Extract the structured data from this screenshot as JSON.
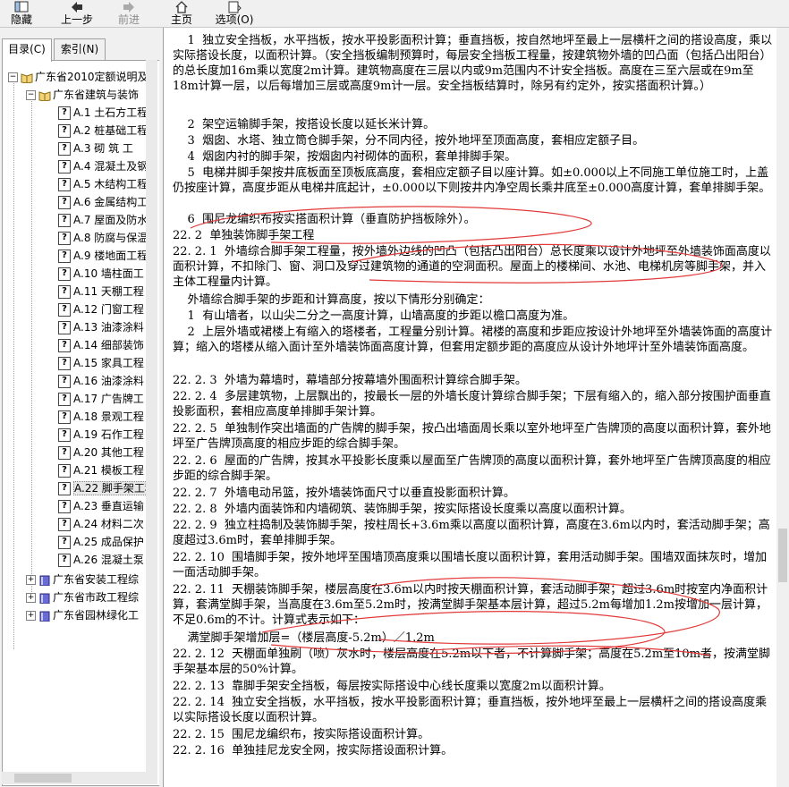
{
  "toolbar": {
    "hide": "隐藏",
    "back": "上一步",
    "forward": "前进",
    "home": "主页",
    "options": "选项(O)"
  },
  "tabs": {
    "contents": "目录(C)",
    "index": "索引(N)"
  },
  "tree": {
    "root": "广东省2010定额说明及",
    "book1": "广东省建筑与装饰",
    "items": [
      "A.1  土石方工程",
      "A.2  桩基础工程",
      "A.3  砌  筑  工",
      "A.4  混凝土及钢",
      "A.5  木结构工程",
      "A.6  金属结构工",
      "A.7  屋面及防水",
      "A.8  防腐与保温",
      "A.9  楼地面工程",
      "A.10  墙柱面工",
      "A.11  天棚工程",
      "A.12  门窗工程",
      "A.13  油漆涂料",
      "A.14  细部装饰",
      "A.15  家具工程",
      "A.16  油漆涂料",
      "A.17  广告牌工",
      "A.18  景观工程",
      "A.19  石作工程",
      "A.20  其他工程",
      "A.21  模板工程",
      "A.22  脚手架工程",
      "A.23  垂直运输",
      "A.24  材料二次",
      "A.25  成品保护",
      "A.26  混凝土泵"
    ],
    "book2": "广东省安装工程综",
    "book3": "广东省市政工程综",
    "book4": "广东省园林绿化工"
  },
  "content": {
    "lines": [
      "    1  独立安全挡板，水平挡板，按水平投影面积计算；垂直挡板，按自然地坪至最上一层横杆之间的搭设高度，乘以实际搭设长度，以面积计算。（安全挡板编制预算时，每层安全挡板工程量，按建筑物外墙的凹凸面（包括凸出阳台）的总长度加16m乘以宽度2m计算。建筑物高度在三层以内或9m范围内不计安全挡板。高度在三至六层或在9m至18m计算一层，以后每增加三层或高度9m计一层。安全挡板结算时，除另有约定外，按实搭面积计算。）",
      "    2  架空运输脚手架，按搭设长度以延长米计算。",
      "    3  烟囱、水塔、独立筒仓脚手架，分不同内径，按外地坪至顶面高度，套相应定额子目。",
      "    4  烟囱内衬的脚手架，按烟囱内衬砌体的面积，套单排脚手架。",
      "    5  电梯井脚手架按井底板面至顶板底高度，套相应定额子目以座计算。如±0.000以上不同施工单位施工时，上盖仍按座计算，高度步距从电梯井底起计，±0.000以下则按井内净空周长乘井底至±0.000高度计算，套单排脚手架。",
      "    6  围尼龙编织布按实搭面积计算（垂直防护挡板除外）。",
      "22. 2  单独装饰脚手架工程",
      "22. 2. 1  外墙综合脚手架工程量，按外墙外边线的凹凸（包括凸出阳台）总长度乘以设计外地坪至外墙装饰面高度以面积计算，不扣除门、窗、洞口及穿过建筑物的通道的空洞面积。屋面上的楼梯间、水池、电梯机房等脚手架，并入主体工程量内计算。",
      "    外墙综合脚手架的步距和计算高度，按以下情形分别确定：",
      "    1  有山墙者，以山尖二分之一高度计算，山墙高度的步距以檐口高度为准。",
      "    2  上层外墙或裙楼上有缩入的塔楼者，工程量分别计算。裙楼的高度和步距应按设计外地坪至外墙装饰面的高度计算；缩入的塔楼从缩入面计至外墙装饰面高度计算，但套用定额步距的高度应从设计外地坪计至外墙装饰面高度。",
      "22. 2. 3  外墙为幕墙时，幕墙部分按幕墙外围面积计算综合脚手架。",
      "22. 2. 4  多层建筑物，上层飘出的，按最长一层的外墙长度计算综合脚手架；下层有缩入的，缩入部分按围护面垂直投影面积，套相应高度单排脚手架计算。",
      "22. 2. 5  单独制作突出墙面的广告牌的脚手架，按凸出墙面周长乘以室外地坪至广告牌顶的高度以面积计算，套外地坪至广告牌顶高度的相应步距的综合脚手架。",
      "22. 2. 6  屋面的广告牌，按其水平投影长度乘以屋面至广告牌顶的高度以面积计算，套外地坪至广告牌顶高度的相应步距的综合脚手架。",
      "22. 2. 7  外墙电动吊篮，按外墙装饰面尺寸以垂直投影面积计算。",
      "22. 2. 8  外墙内面装饰和内墙砌筑、装饰脚手架，按实际搭设长度乘以高度以面积计算。",
      "22. 2. 9  独立柱捣制及装饰脚手架，按柱周长+3.6m乘以高度以面积计算，高度在3.6m以内时，套活动脚手架；高度超过3.6m时，套单排脚手架。",
      "22. 2. 10  围墙脚手架，按外地坪至围墙顶高度乘以围墙长度以面积计算，套用活动脚手架。围墙双面抹灰时，增加一面活动脚手架。",
      "22. 2. 11  天棚装饰脚手架，楼层高度在3.6m以内时按天棚面积计算，套活动脚手架；超过3.6m时按室内净面积计算，套满堂脚手架，当高度在3.6m至5.2m时，按满堂脚手架基本层计算，超过5.2m每增加1.2m按增加一层计算，不足0.6m的不计。计算式表示如下：",
      "    满堂脚手架增加层=（楼层高度-5.2m）／1.2m",
      "22. 2. 12  天棚面单独刷（喷）灰水时，楼层高度在5.2m以下者，不计算脚手架；高度在5.2m至10m者，按满堂脚手架基本层的50%计算。",
      "22. 2. 13  靠脚手架安全挡板，每层按实际搭设中心线长度乘以宽度2m以面积计算。",
      "22. 2. 14  独立安全挡板，水平挡板，按水平投影面积计算；垂直挡板，按外地坪至最上一层横杆之间的搭设高度乘以实际搭设长度以面积计算。",
      "22. 2. 15  围尼龙编织布，按实际搭设面积计算。",
      "22. 2. 16  单独挂尼龙安全网，按实际搭设面积计算。"
    ]
  },
  "colors": {
    "annotation": "#e23a3a",
    "selected_bg": "#e8e8e8"
  }
}
